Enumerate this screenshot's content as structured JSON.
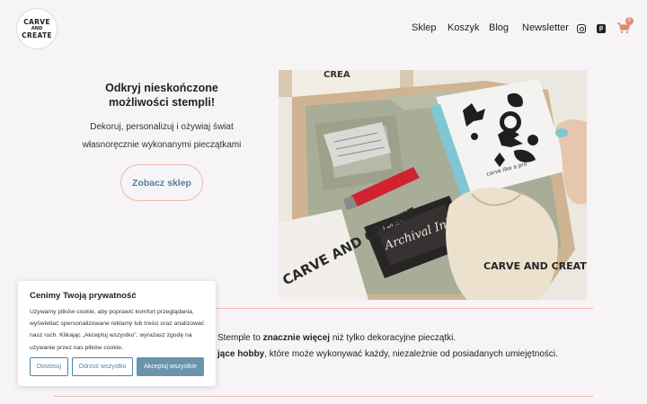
{
  "logo": {
    "line1": "CARVE",
    "line2": "AND",
    "line3": "CREATE"
  },
  "nav": {
    "items": [
      "Sklep",
      "Koszyk",
      "Blog",
      "Newsletter"
    ]
  },
  "icons": [
    "instagram-icon",
    "pinterest-icon",
    "cart-icon"
  ],
  "cart": {
    "count": "0"
  },
  "hero": {
    "title": "Odkryj nieskończone możliwości stempli!",
    "subtitle": "Dekoruj, personalizuj i ożywiaj świat własnoręcznie wykonanymi pieczątkami",
    "button": "Zobacz sklep"
  },
  "photo": {
    "box_label": "CREA",
    "brand": "CARVE AND CREATE",
    "ink_brand": "Archival Ink",
    "ink_maker": "Ranger",
    "bag_label": "CARVE AND CREATE",
    "card_text": "carve like a pro"
  },
  "intro": {
    "line1_pre": "Stemple to ",
    "line1_bold": "znacznie więcej",
    "line1_post": " niż tylko dekoracyjne pieczątki.",
    "line2_bold": "jące hobby",
    "line2_post": ", które może wykonywać każdy, niezależnie od posiadanych umiejętności."
  },
  "cookie": {
    "title": "Cenimy Twoją prywatność",
    "text": "Używamy plików cookie, aby poprawić komfort przeglądania, wyświetlać spersonalizowane reklamy lub treści oraz analizować nasz ruch. Klikając „Akceptuj wszystko”, wyrażasz zgodę na używanie przez nas plików cookie.",
    "btn_customize": "Dostosuj",
    "btn_reject": "Odrzuć wszystko",
    "btn_accept": "Akceptuj wszystkie"
  },
  "colors": {
    "accent": "#4f82a3",
    "peach": "#f0b9a6",
    "badge": "#e28a6a",
    "accept_bg": "#6994aa"
  }
}
